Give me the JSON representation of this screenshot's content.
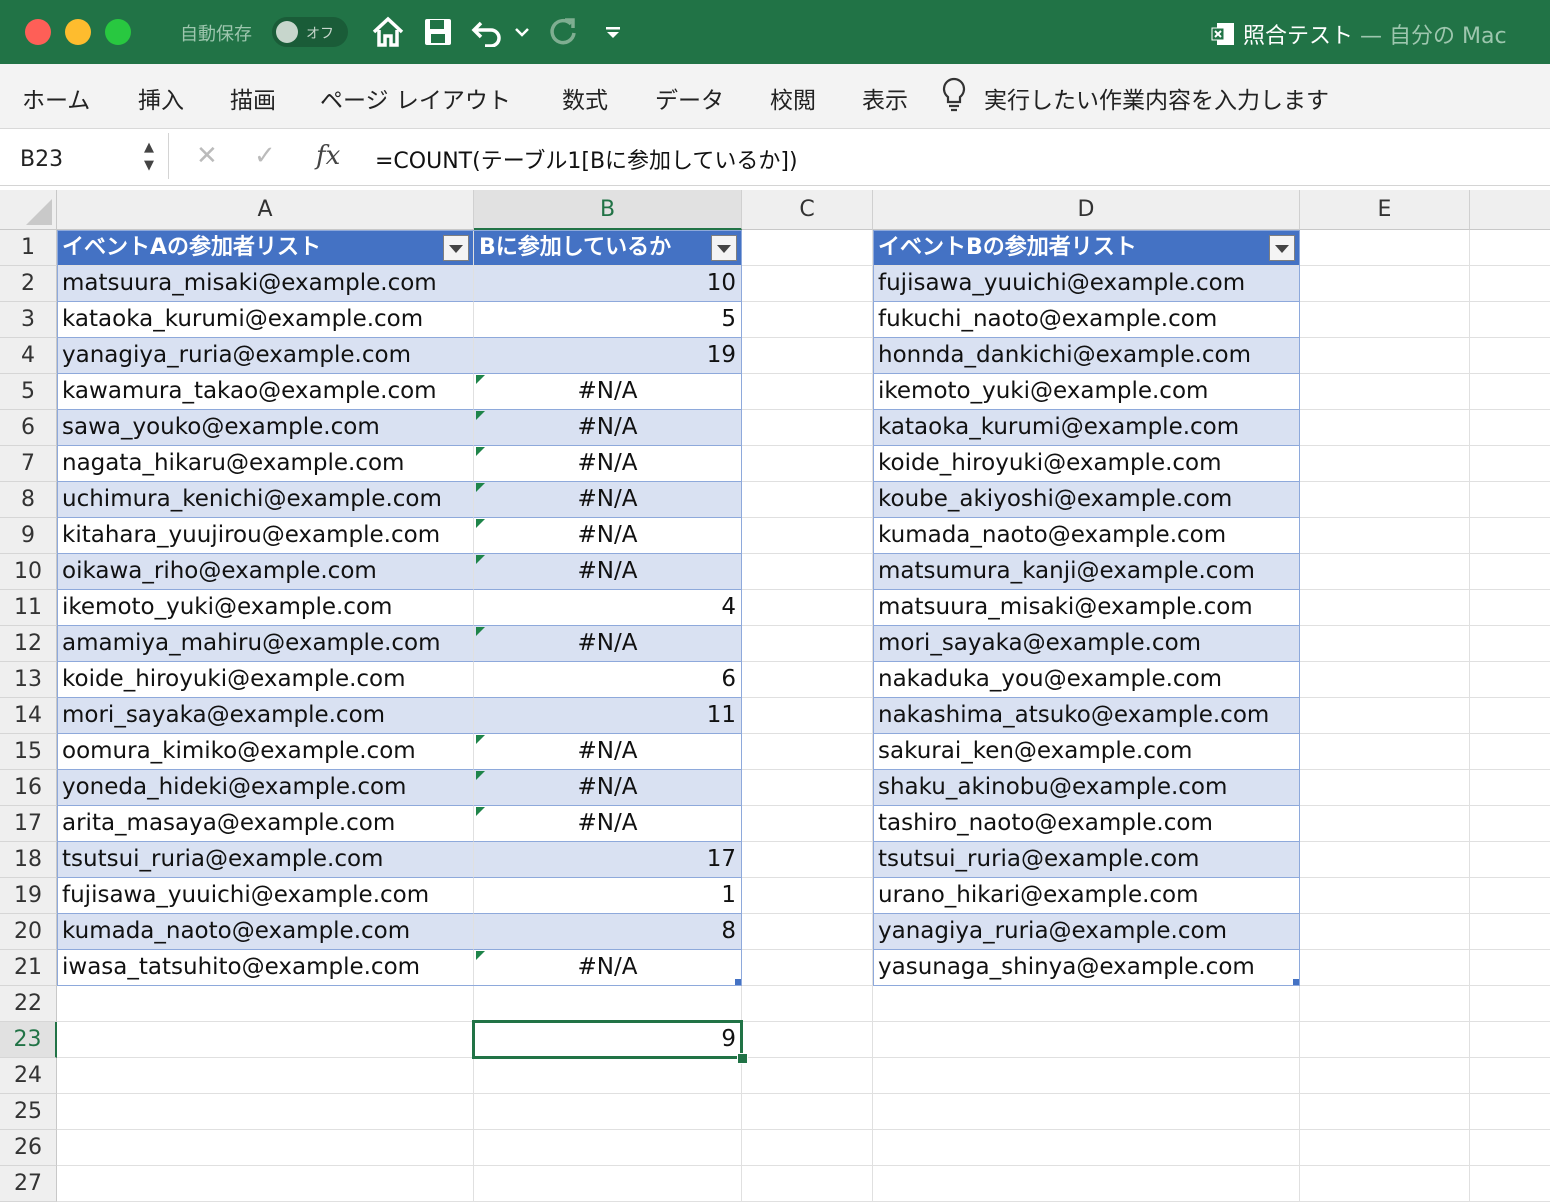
{
  "titlebar": {
    "autosave_label": "自動保存",
    "toggle_label": "オフ",
    "document_title": "照合テスト",
    "document_location": " — 自分の Mac"
  },
  "ribbon": {
    "tabs": [
      "ホーム",
      "挿入",
      "描画",
      "ページ レイアウト",
      "数式",
      "データ",
      "校閲",
      "表示"
    ],
    "tell_me": "実行したい作業内容を入力します"
  },
  "formula_bar": {
    "name_box": "B23",
    "fx": "fx",
    "formula": "=COUNT(テーブル1[Bに参加しているか])"
  },
  "columns": [
    "A",
    "B",
    "C",
    "D",
    "E"
  ],
  "rows": [
    "1",
    "2",
    "3",
    "4",
    "5",
    "6",
    "7",
    "8",
    "9",
    "10",
    "11",
    "12",
    "13",
    "14",
    "15",
    "16",
    "17",
    "18",
    "19",
    "20",
    "21",
    "22",
    "23",
    "24",
    "25",
    "26",
    "27"
  ],
  "table_a": {
    "header_a": "イベントAの参加者リスト",
    "header_b": "Bに参加しているか",
    "emails": [
      "matsuura_misaki@example.com",
      "kataoka_kurumi@example.com",
      "yanagiya_ruria@example.com",
      "kawamura_takao@example.com",
      "sawa_youko@example.com",
      "nagata_hikaru@example.com",
      "uchimura_kenichi@example.com",
      "kitahara_yuujirou@example.com",
      "oikawa_riho@example.com",
      "ikemoto_yuki@example.com",
      "amamiya_mahiru@example.com",
      "koide_hiroyuki@example.com",
      "mori_sayaka@example.com",
      "oomura_kimiko@example.com",
      "yoneda_hideki@example.com",
      "arita_masaya@example.com",
      "tsutsui_ruria@example.com",
      "fujisawa_yuuichi@example.com",
      "kumada_naoto@example.com",
      "iwasa_tatsuhito@example.com"
    ],
    "results": [
      "10",
      "5",
      "19",
      "#N/A",
      "#N/A",
      "#N/A",
      "#N/A",
      "#N/A",
      "#N/A",
      "4",
      "#N/A",
      "6",
      "11",
      "#N/A",
      "#N/A",
      "#N/A",
      "17",
      "1",
      "8",
      "#N/A"
    ]
  },
  "table_b": {
    "header": "イベントBの参加者リスト",
    "emails": [
      "fujisawa_yuuichi@example.com",
      "fukuchi_naoto@example.com",
      "honnda_dankichi@example.com",
      "ikemoto_yuki@example.com",
      "kataoka_kurumi@example.com",
      "koide_hiroyuki@example.com",
      "koube_akiyoshi@example.com",
      "kumada_naoto@example.com",
      "matsumura_kanji@example.com",
      "matsuura_misaki@example.com",
      "mori_sayaka@example.com",
      "nakaduka_you@example.com",
      "nakashima_atsuko@example.com",
      "sakurai_ken@example.com",
      "shaku_akinobu@example.com",
      "tashiro_naoto@example.com",
      "tsutsui_ruria@example.com",
      "urano_hikari@example.com",
      "yanagiya_ruria@example.com",
      "yasunaga_shinya@example.com"
    ]
  },
  "selected_cell_value": "9",
  "colors": {
    "excel_green": "#217346",
    "table_header": "#4472c4",
    "band": "#d9e1f2"
  }
}
